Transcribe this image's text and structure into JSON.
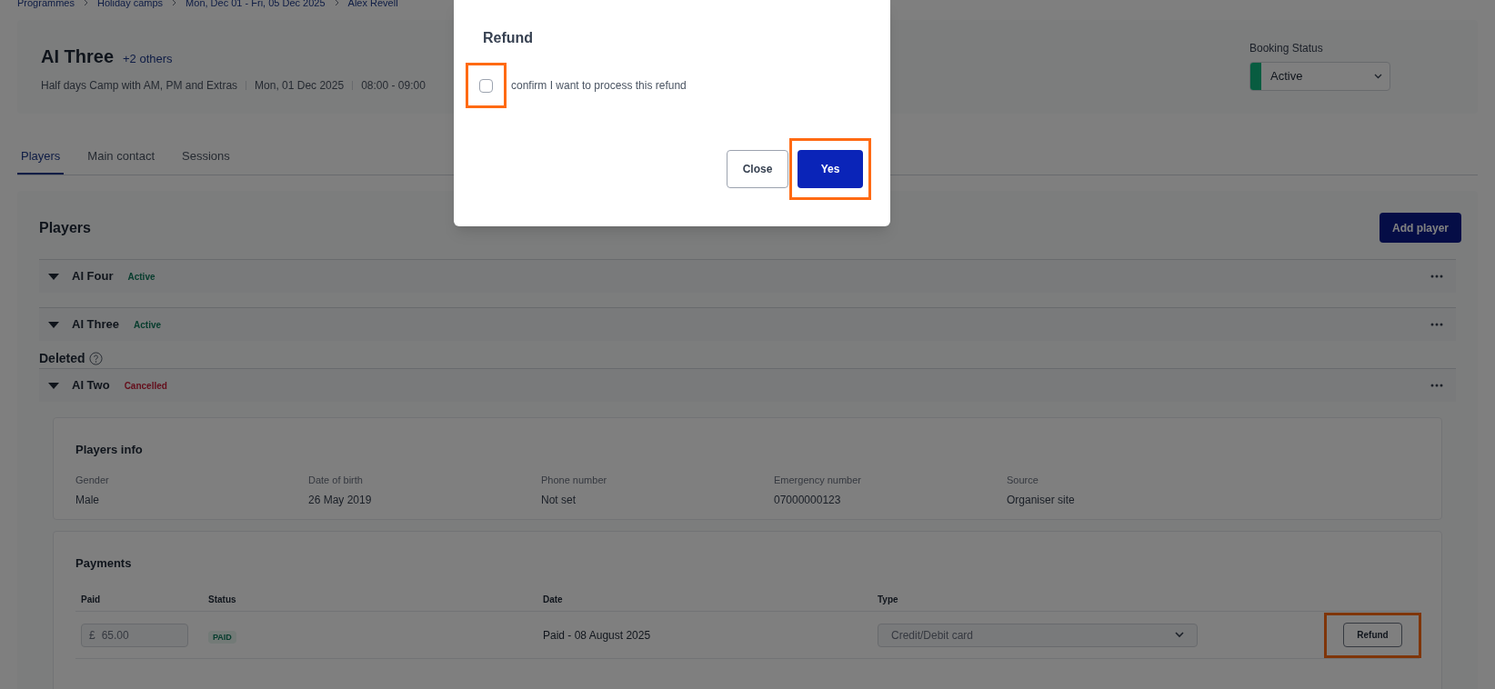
{
  "breadcrumb": [
    "Programmes",
    "Holiday camps",
    "Mon, Dec 01 - Fri, 05 Dec 2025",
    "Alex Revell"
  ],
  "header": {
    "title": "AI Three",
    "others_link": "+2 others",
    "meta": [
      "Half days Camp with AM, PM and Extras",
      "Mon, 01 Dec 2025",
      "08:00 - 09:00"
    ],
    "booking_status_label": "Booking Status",
    "booking_status": "Active"
  },
  "tabs": [
    {
      "label": "Players",
      "selected": true
    },
    {
      "label": "Main contact",
      "selected": false
    },
    {
      "label": "Sessions",
      "selected": false
    }
  ],
  "players": {
    "title": "Players",
    "add_button": "Add player",
    "rows": [
      {
        "name": "AI Four",
        "status": "Active",
        "kind": "active"
      },
      {
        "name": "AI Three",
        "status": "Active",
        "kind": "active"
      }
    ],
    "deleted_label": "Deleted",
    "deleted_rows": [
      {
        "name": "AI Two",
        "status": "Cancelled",
        "kind": "cancelled"
      }
    ],
    "info": {
      "title": "Players info",
      "fields": [
        {
          "label": "Gender",
          "value": "Male"
        },
        {
          "label": "Date of birth",
          "value": "26 May 2019"
        },
        {
          "label": "Phone number",
          "value": "Not set"
        },
        {
          "label": "Emergency number",
          "value": "07000000123"
        },
        {
          "label": "Source",
          "value": "Organiser site"
        }
      ]
    },
    "payments": {
      "title": "Payments",
      "columns": [
        "Paid",
        "Status",
        "Date",
        "Type"
      ],
      "rows": [
        {
          "currency": "£",
          "amount": "65.00",
          "status": "PAID",
          "date": "Paid - 08 August 2025",
          "type": "Credit/Debit card",
          "action": "Refund"
        }
      ]
    }
  },
  "modal": {
    "title": "Refund",
    "checkbox_label": "confirm I want to process this refund",
    "checked": false,
    "buttons": [
      {
        "label": "Close",
        "kind": "secondary"
      },
      {
        "label": "Yes",
        "kind": "primary"
      }
    ]
  }
}
